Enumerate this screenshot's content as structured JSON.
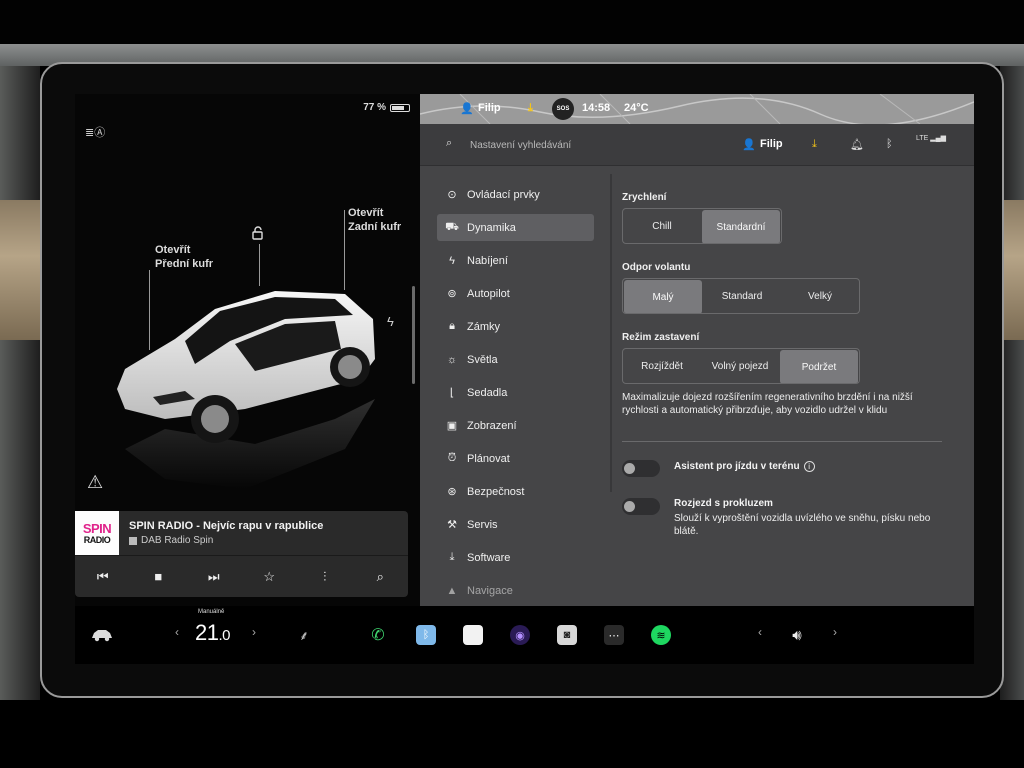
{
  "status_bar": {
    "battery": "77 %",
    "battery_level_percent": 77,
    "user": "Filip",
    "time": "14:58",
    "temperature": "24°C",
    "sos": "SOS"
  },
  "car_view": {
    "front_trunk_line1": "Otevřít",
    "front_trunk_line2": "Přední kufr",
    "rear_trunk_line1": "Otevřít",
    "rear_trunk_line2": "Zadní kufr"
  },
  "media": {
    "logo_top": "SPIN",
    "logo_bottom": "RADIO",
    "title": "SPIN RADIO - Nejvíc rapu v rapublice",
    "source": "DAB Radio Spin"
  },
  "search": {
    "placeholder": "Nastavení vyhledávání"
  },
  "header": {
    "user": "Filip",
    "signal": "LTE"
  },
  "nav": {
    "items": [
      {
        "label": "Ovládací prvky",
        "icon": "toggle-icon"
      },
      {
        "label": "Dynamika",
        "icon": "car-icon"
      },
      {
        "label": "Nabíjení",
        "icon": "bolt-icon"
      },
      {
        "label": "Autopilot",
        "icon": "steering-wheel-icon"
      },
      {
        "label": "Zámky",
        "icon": "lock-icon"
      },
      {
        "label": "Světla",
        "icon": "sun-icon"
      },
      {
        "label": "Sedadla",
        "icon": "seat-icon"
      },
      {
        "label": "Zobrazení",
        "icon": "display-icon"
      },
      {
        "label": "Plánovat",
        "icon": "alarm-clock-icon"
      },
      {
        "label": "Bezpečnost",
        "icon": "shield-icon"
      },
      {
        "label": "Servis",
        "icon": "wrench-icon"
      },
      {
        "label": "Software",
        "icon": "download-icon"
      },
      {
        "label": "Navigace",
        "icon": "navigation-icon"
      }
    ],
    "active": "Dynamika"
  },
  "dynamics": {
    "acceleration": {
      "label": "Zrychlení",
      "options": [
        "Chill",
        "Standardní"
      ],
      "selected": "Standardní"
    },
    "steering": {
      "label": "Odpor volantu",
      "options": [
        "Malý",
        "Standard",
        "Velký"
      ],
      "selected": "Malý"
    },
    "stopping": {
      "label": "Režim zastavení",
      "options": [
        "Rozjíždět",
        "Volný pojezd",
        "Podržet"
      ],
      "selected": "Podržet",
      "description": "Maximalizuje dojezd rozšířením regenerativního brzdění i na nižší rychlosti a automatický přibrzďuje, aby vozidlo udržel v klidu"
    },
    "offroad": {
      "label": "Asistent pro jízdu v terénu",
      "enabled": false
    },
    "slip_start": {
      "label": "Rozjezd s prokluzem",
      "description": "Slouží k vyproštění vozidla uvízlého ve sněhu, písku nebo blátě.",
      "enabled": false
    }
  },
  "dock": {
    "climate_mode": "Manuálně",
    "temperature_int": "21",
    "temperature_dec": ".0",
    "apps": [
      "phone-icon",
      "bluetooth-app-icon",
      "notes-app-icon",
      "camera-app-icon",
      "dashcam-app-icon",
      "more-apps-icon",
      "spotify-icon"
    ]
  },
  "colors": {
    "settings_bg": "#454547",
    "selected_segment": "#7a7a7d",
    "active_nav": "#5f5f62",
    "logo_pink": "#e0238b",
    "spotify_green": "#1ed760",
    "download_yellow": "#f5c518"
  }
}
